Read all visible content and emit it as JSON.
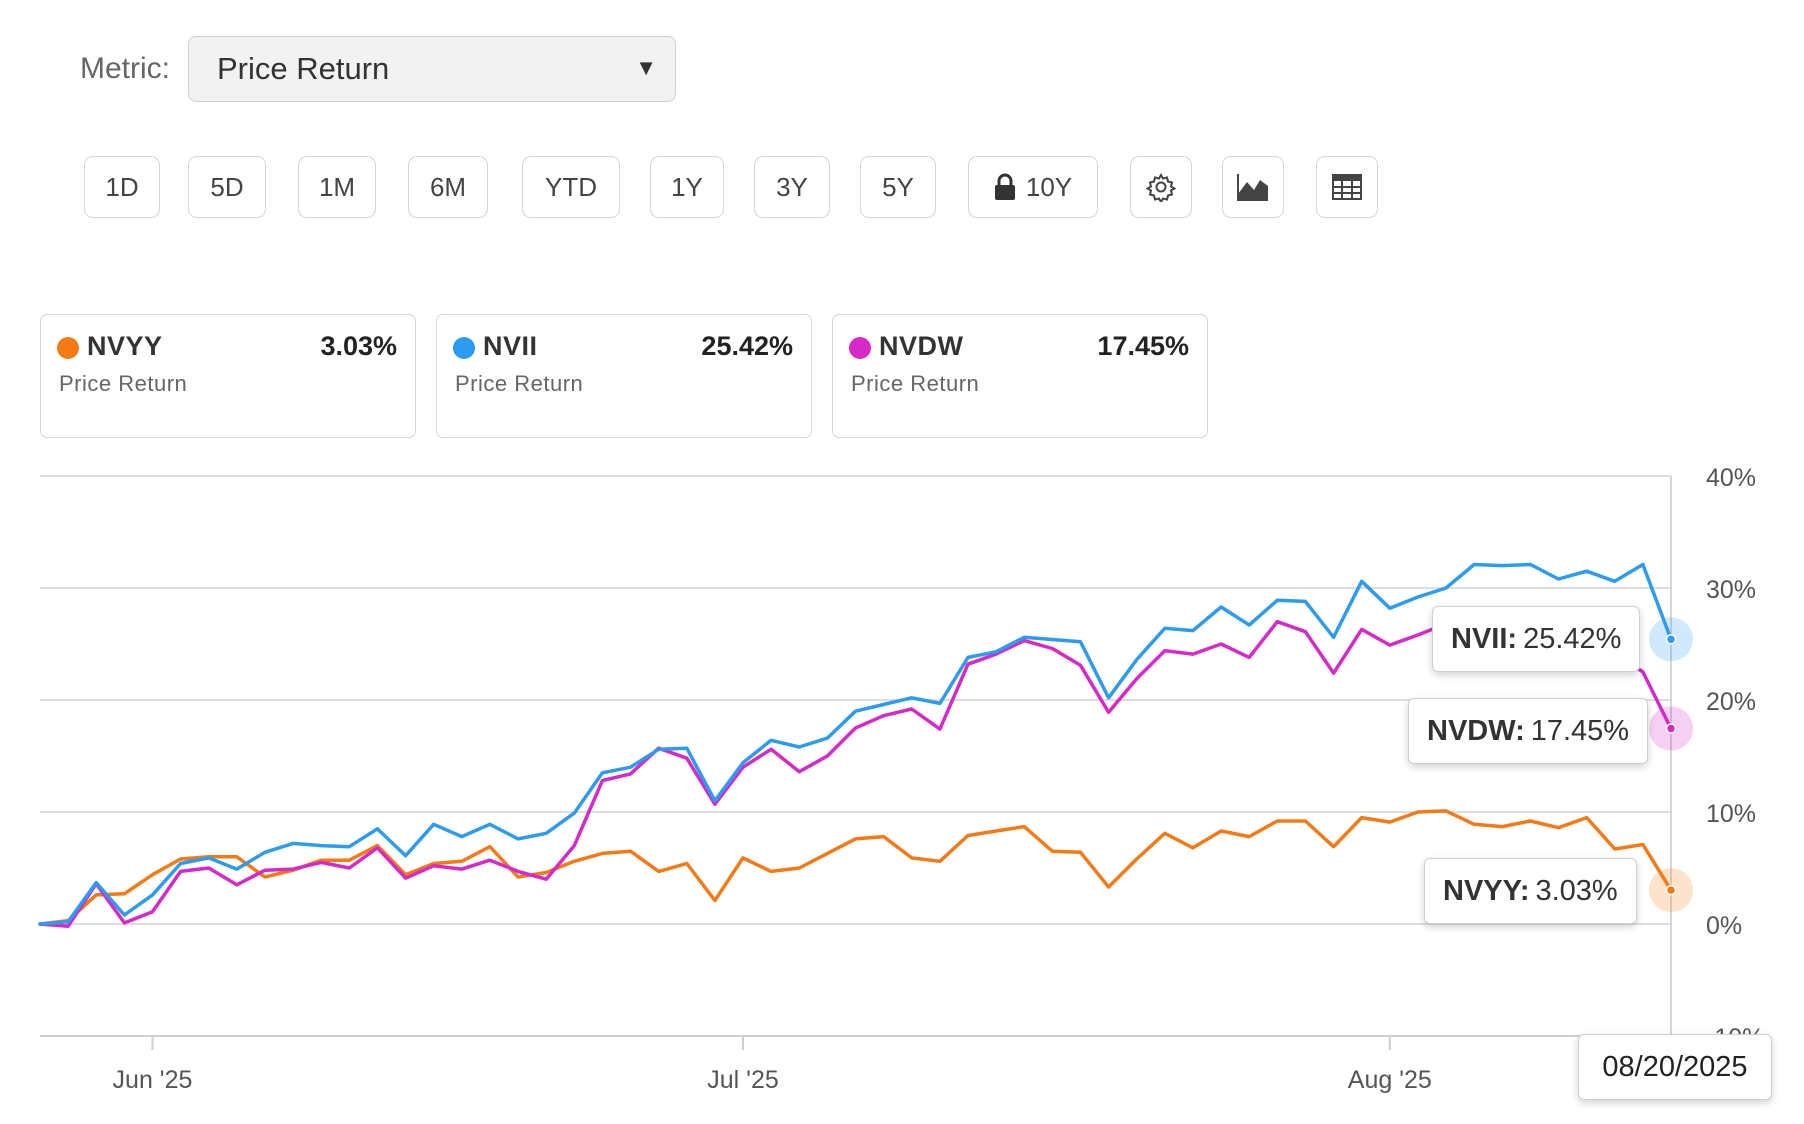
{
  "metric": {
    "label": "Metric:",
    "selected": "Price Return",
    "caret": "▼"
  },
  "ranges": [
    {
      "label": "1D"
    },
    {
      "label": "5D"
    },
    {
      "label": "1M"
    },
    {
      "label": "6M"
    },
    {
      "label": "YTD"
    },
    {
      "label": "1Y"
    },
    {
      "label": "3Y"
    },
    {
      "label": "5Y"
    },
    {
      "label": "10Y",
      "icon": "lock-icon"
    }
  ],
  "tools": [
    {
      "icon": "gear-icon"
    },
    {
      "icon": "area-chart-icon"
    },
    {
      "icon": "table-icon"
    }
  ],
  "cards": [
    {
      "ticker": "NVYY",
      "value": "3.03%",
      "sub": "Price Return",
      "color": "#f47a16"
    },
    {
      "ticker": "NVII",
      "value": "25.42%",
      "sub": "Price Return",
      "color": "#2d9bf0"
    },
    {
      "ticker": "NVDW",
      "value": "17.45%",
      "sub": "Price Return",
      "color": "#d62ac8"
    }
  ],
  "tooltips": {
    "nvii": {
      "ticker": "NVII:",
      "value": "25.42%"
    },
    "nvdw": {
      "ticker": "NVDW:",
      "value": "17.45%"
    },
    "nvyy": {
      "ticker": "NVYY:",
      "value": "3.03%"
    },
    "date": "08/20/2025"
  },
  "chart_data": {
    "type": "line",
    "y_ticks": [
      "40%",
      "30%",
      "20%",
      "10%",
      "0%",
      "-10%"
    ],
    "ylim": [
      -10,
      40
    ],
    "x_ticks": [
      {
        "label": "Jun '25",
        "index": 4
      },
      {
        "label": "Jul '25",
        "index": 25
      },
      {
        "label": "Aug '25",
        "index": 48
      }
    ],
    "grid": true,
    "series": [
      {
        "name": "NVYY",
        "color": "#f47a16",
        "values": [
          0,
          0.3,
          2.6,
          2.7,
          4.4,
          5.8,
          6.0,
          6.0,
          4.2,
          4.8,
          5.7,
          5.7,
          7.0,
          4.4,
          5.4,
          5.6,
          6.9,
          4.2,
          4.6,
          5.6,
          6.3,
          6.5,
          4.7,
          5.4,
          2.1,
          5.9,
          4.7,
          5.0,
          6.3,
          7.6,
          7.8,
          5.9,
          5.6,
          7.9,
          8.3,
          8.7,
          6.5,
          6.4,
          3.3,
          5.8,
          8.1,
          6.8,
          8.3,
          7.8,
          9.2,
          9.2,
          6.9,
          9.5,
          9.1,
          10.0,
          10.1,
          8.9,
          8.7,
          9.2,
          8.6,
          9.5,
          6.7,
          7.1,
          3.03
        ]
      },
      {
        "name": "NVII",
        "color": "#2d9bf0",
        "values": [
          0,
          0.2,
          3.7,
          0.8,
          2.6,
          5.4,
          5.9,
          4.9,
          6.4,
          7.2,
          7.0,
          6.9,
          8.5,
          6.1,
          8.9,
          7.8,
          8.9,
          7.6,
          8.1,
          9.9,
          13.5,
          14.0,
          15.6,
          15.7,
          11.0,
          14.4,
          16.4,
          15.8,
          16.6,
          19.0,
          19.6,
          20.2,
          19.7,
          23.8,
          24.3,
          25.6,
          25.4,
          25.2,
          20.2,
          23.6,
          26.4,
          26.2,
          28.3,
          26.7,
          28.9,
          28.8,
          25.6,
          30.6,
          28.2,
          29.2,
          30.0,
          32.1,
          32.0,
          32.1,
          30.8,
          31.5,
          30.6,
          32.1,
          25.42
        ]
      },
      {
        "name": "NVDW",
        "color": "#d62ac8",
        "values": [
          0,
          -0.2,
          3.6,
          0.1,
          1.1,
          4.7,
          5.0,
          3.5,
          4.8,
          4.9,
          5.5,
          5.0,
          6.8,
          4.1,
          5.2,
          4.9,
          5.7,
          4.7,
          4.0,
          7.0,
          12.8,
          13.4,
          15.7,
          14.8,
          10.7,
          14.0,
          15.6,
          13.6,
          15.0,
          17.5,
          18.6,
          19.2,
          17.4,
          23.2,
          24.1,
          25.3,
          24.6,
          23.1,
          18.9,
          21.9,
          24.4,
          24.1,
          25.0,
          23.8,
          27.0,
          26.1,
          22.4,
          26.3,
          24.9,
          25.8,
          26.8,
          27.4,
          25.5,
          26.3,
          24.8,
          25.3,
          24.2,
          22.5,
          17.45
        ]
      }
    ]
  }
}
